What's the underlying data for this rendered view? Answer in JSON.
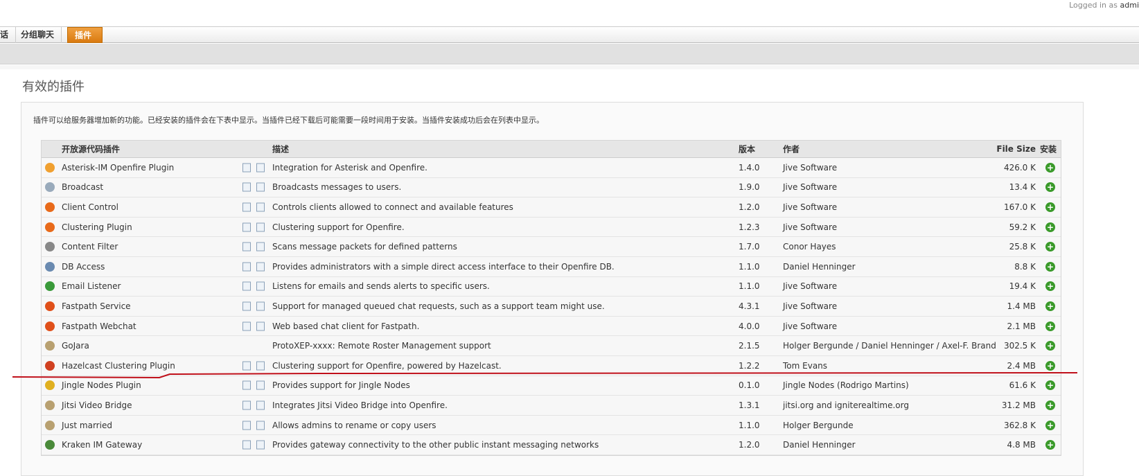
{
  "header": {
    "login_prefix": "Logged in as",
    "login_user": "admi"
  },
  "tabs": [
    {
      "label": "话"
    },
    {
      "label": "分组聊天"
    },
    {
      "label": "插件",
      "active": true
    }
  ],
  "page_title": "有效的插件",
  "intro": "插件可以给服务器增加新的功能。已经安装的插件会在下表中显示。当插件已经下载后可能需要一段时间用于安装。当插件安装成功后会在列表中显示。",
  "table": {
    "headers": {
      "name": "开放源代码插件",
      "desc": "描述",
      "version": "版本",
      "author": "作者",
      "size": "File Size",
      "install": "安装"
    },
    "rows": [
      {
        "icon": "asterisk-icon",
        "color": "#f0a030",
        "name": "Asterisk-IM Openfire Plugin",
        "docs": true,
        "desc": "Integration for Asterisk and Openfire.",
        "version": "1.4.0",
        "author": "Jive Software",
        "size": "426.0 K"
      },
      {
        "icon": "broadcast-icon",
        "color": "#9ab",
        "name": "Broadcast",
        "docs": true,
        "desc": "Broadcasts messages to users.",
        "version": "1.9.0",
        "author": "Jive Software",
        "size": "13.4 K"
      },
      {
        "icon": "openfire-icon",
        "color": "#e86a1a",
        "name": "Client Control",
        "docs": true,
        "desc": "Controls clients allowed to connect and available features",
        "version": "1.2.0",
        "author": "Jive Software",
        "size": "167.0 K"
      },
      {
        "icon": "openfire-icon",
        "color": "#e86a1a",
        "name": "Clustering Plugin",
        "docs": true,
        "desc": "Clustering support for Openfire.",
        "version": "1.2.3",
        "author": "Jive Software",
        "size": "59.2 K"
      },
      {
        "icon": "filter-icon",
        "color": "#888",
        "name": "Content Filter",
        "docs": true,
        "desc": "Scans message packets for defined patterns",
        "version": "1.7.0",
        "author": "Conor Hayes",
        "size": "25.8 K"
      },
      {
        "icon": "database-icon",
        "color": "#6a8ab0",
        "name": "DB Access",
        "docs": true,
        "desc": "Provides administrators with a simple direct access interface to their Openfire DB.",
        "version": "1.1.0",
        "author": "Daniel Henninger",
        "size": "8.8 K"
      },
      {
        "icon": "email-icon",
        "color": "#3a9a3a",
        "name": "Email Listener",
        "docs": true,
        "desc": "Listens for emails and sends alerts to specific users.",
        "version": "1.1.0",
        "author": "Jive Software",
        "size": "19.4 K"
      },
      {
        "icon": "fastpath-icon",
        "color": "#e0501a",
        "name": "Fastpath Service",
        "docs": true,
        "desc": "Support for managed queued chat requests, such as a support team might use.",
        "version": "4.3.1",
        "author": "Jive Software",
        "size": "1.4 MB"
      },
      {
        "icon": "fastpath-icon",
        "color": "#e0501a",
        "name": "Fastpath Webchat",
        "docs": true,
        "desc": "Web based chat client for Fastpath.",
        "version": "4.0.0",
        "author": "Jive Software",
        "size": "2.1 MB"
      },
      {
        "icon": "plugin-icon",
        "color": "#b8a070",
        "name": "GoJara",
        "docs": false,
        "desc": "ProtoXEP-xxxx: Remote Roster Management support",
        "version": "2.1.5",
        "author": "Holger Bergunde / Daniel Henninger / Axel-F. Brand",
        "size": "302.5 K"
      },
      {
        "icon": "hazelcast-icon",
        "color": "#d04020",
        "name": "Hazelcast Clustering Plugin",
        "docs": true,
        "desc": "Clustering support for Openfire, powered by Hazelcast.",
        "version": "1.2.2",
        "author": "Tom Evans",
        "size": "2.4 MB"
      },
      {
        "icon": "jingle-icon",
        "color": "#e0b020",
        "name": "Jingle Nodes Plugin",
        "docs": true,
        "desc": "Provides support for Jingle Nodes",
        "version": "0.1.0",
        "author": "Jingle Nodes (Rodrigo Martins)",
        "size": "61.6 K"
      },
      {
        "icon": "plugin-icon",
        "color": "#b8a070",
        "name": "Jitsi Video Bridge",
        "docs": true,
        "desc": "Integrates Jitsi Video Bridge into Openfire.",
        "version": "1.3.1",
        "author": "jitsi.org and igniterealtime.org",
        "size": "31.2 MB"
      },
      {
        "icon": "plugin-icon",
        "color": "#b8a070",
        "name": "Just married",
        "docs": true,
        "desc": "Allows admins to rename or copy users",
        "version": "1.1.0",
        "author": "Holger Bergunde",
        "size": "362.8 K"
      },
      {
        "icon": "kraken-icon",
        "color": "#4a8a3a",
        "name": "Kraken IM Gateway",
        "docs": true,
        "desc": "Provides gateway connectivity to the other public instant messaging networks",
        "version": "1.2.0",
        "author": "Daniel Henninger",
        "size": "4.8 MB"
      }
    ]
  },
  "annotation_color": "#c0101a"
}
